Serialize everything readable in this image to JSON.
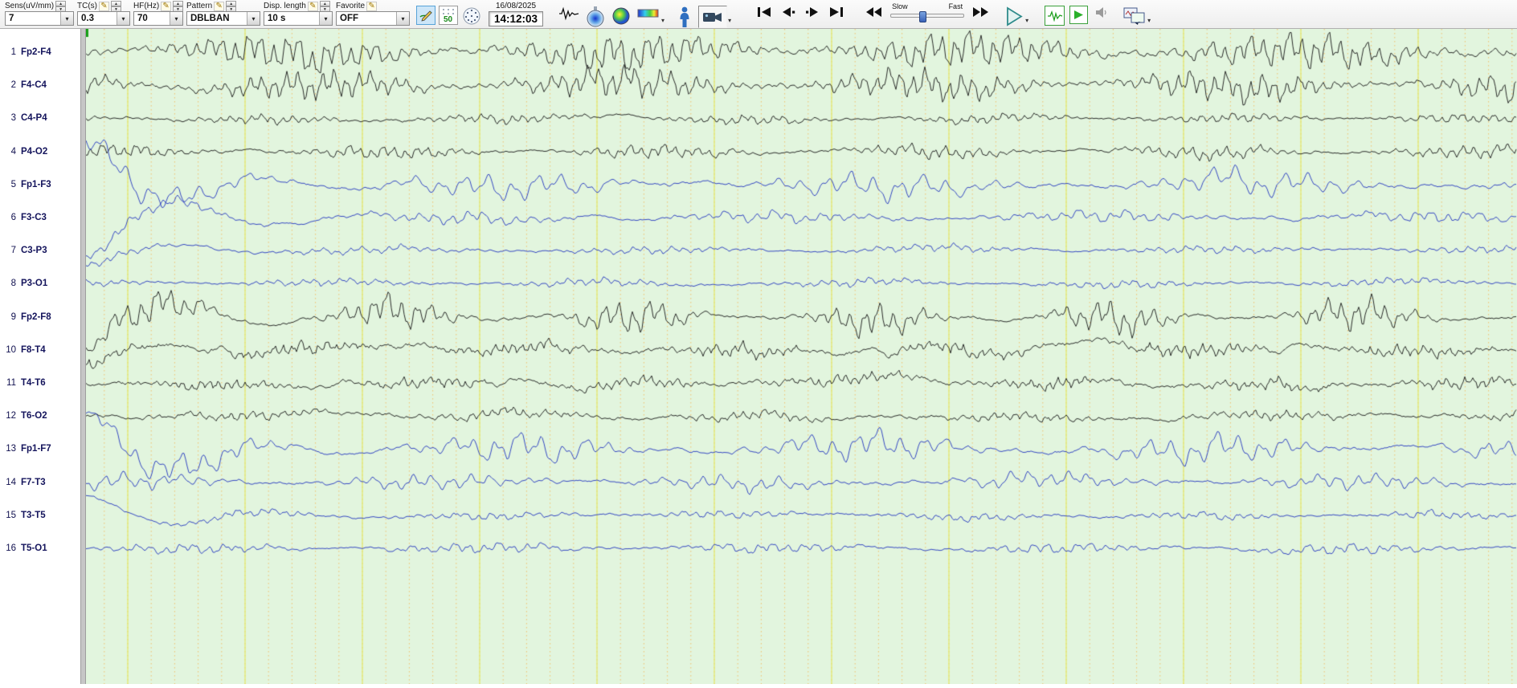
{
  "glyphs": {
    "pencil": "✎",
    "spin_up": "▲",
    "spin_down": "▼",
    "combo_arrow": "▾",
    "menu_arrow": "▾"
  },
  "toolbar": {
    "groups": [
      {
        "label": "Sens(uV/mm)",
        "value": "7"
      },
      {
        "label": "TC(s)",
        "value": "0.3"
      },
      {
        "label": "HF(Hz)",
        "value": "70"
      },
      {
        "label": "Pattern",
        "value": "DBLBAN"
      },
      {
        "label": "Disp. length",
        "value": "10 s"
      },
      {
        "label": "Favorite",
        "value": "OFF"
      }
    ],
    "notch": {
      "label": "50"
    },
    "datetime": {
      "date": "16/08/2025",
      "time": "14:12:03"
    },
    "transport": {
      "slow_label": "Slow",
      "fast_label": "Fast"
    }
  },
  "channels": [
    {
      "num": "1",
      "label": "Fp2-F4",
      "color": "black",
      "amp": 24,
      "T": 16,
      "burstT": 420,
      "burstK": 0.9,
      "noise": 1.5,
      "trans": 0,
      "seed": 101
    },
    {
      "num": "2",
      "label": "F4-C4",
      "color": "black",
      "amp": 20,
      "T": 15,
      "burstT": 380,
      "burstK": 0.9,
      "noise": 1.3,
      "trans": 0,
      "seed": 202
    },
    {
      "num": "3",
      "label": "C4-P4",
      "color": "black",
      "amp": 6,
      "T": 13,
      "burstT": 300,
      "burstK": 1.0,
      "noise": 1.0,
      "trans": 0,
      "seed": 303
    },
    {
      "num": "4",
      "label": "P4-O2",
      "color": "black",
      "amp": 9,
      "T": 14,
      "burstT": 340,
      "burstK": 1.2,
      "noise": 1.0,
      "trans": 0,
      "seed": 404
    },
    {
      "num": "5",
      "label": "Fp1-F3",
      "color": "blue",
      "amp": 18,
      "T": 30,
      "burstT": 460,
      "burstK": 1.2,
      "noise": 1.4,
      "trans": 55,
      "seed": 505
    },
    {
      "num": "6",
      "label": "F3-C3",
      "color": "blue",
      "amp": 8,
      "T": 20,
      "burstT": 400,
      "burstK": 1.1,
      "noise": 1.2,
      "trans": -50,
      "seed": 606
    },
    {
      "num": "7",
      "label": "C3-P3",
      "color": "blue",
      "amp": 5,
      "T": 16,
      "burstT": 350,
      "burstK": 1.0,
      "noise": 0.9,
      "trans": -18,
      "seed": 707
    },
    {
      "num": "8",
      "label": "P3-O1",
      "color": "blue",
      "amp": 5,
      "T": 15,
      "burstT": 330,
      "burstK": 1.0,
      "noise": 0.8,
      "trans": 0,
      "seed": 808
    },
    {
      "num": "9",
      "label": "Fp2-F8",
      "color": "black",
      "amp": 23,
      "T": 18,
      "burstT": 300,
      "burstK": 2.0,
      "noise": 1.5,
      "trans": -40,
      "seed": 909
    },
    {
      "num": "10",
      "label": "F8-T4",
      "color": "black",
      "amp": 8,
      "T": 11,
      "burstT": 280,
      "burstK": 1.0,
      "noise": 2.6,
      "trans": -20,
      "seed": 1010
    },
    {
      "num": "11",
      "label": "T4-T6",
      "color": "black",
      "amp": 7,
      "T": 11,
      "burstT": 260,
      "burstK": 1.0,
      "noise": 2.2,
      "trans": 0,
      "seed": 1111
    },
    {
      "num": "12",
      "label": "T6-O2",
      "color": "black",
      "amp": 6,
      "T": 13,
      "burstT": 320,
      "burstK": 1.0,
      "noise": 1.6,
      "trans": 0,
      "seed": 1212
    },
    {
      "num": "13",
      "label": "Fp1-F7",
      "color": "blue",
      "amp": 20,
      "T": 28,
      "burstT": 430,
      "burstK": 1.4,
      "noise": 1.4,
      "trans": 45,
      "seed": 1313
    },
    {
      "num": "14",
      "label": "F7-T3",
      "color": "blue",
      "amp": 11,
      "T": 24,
      "burstT": 380,
      "burstK": 1.2,
      "noise": 1.3,
      "trans": 0,
      "seed": 1414
    },
    {
      "num": "15",
      "label": "T3-T5",
      "color": "blue",
      "amp": 5,
      "T": 15,
      "burstT": 300,
      "burstK": 1.0,
      "noise": 1.0,
      "trans": 25,
      "seed": 1515
    },
    {
      "num": "16",
      "label": "T5-O1",
      "color": "blue",
      "amp": 7,
      "T": 18,
      "burstT": 360,
      "burstK": 1.1,
      "noise": 1.0,
      "trans": 0,
      "seed": 1616
    }
  ],
  "grid": {
    "background": "#e2f5de",
    "major_color": "#e4ea72",
    "minor_color": "#f2c06c",
    "major_spacing": 146,
    "minor_spacing": 29.2,
    "offset": 52,
    "row_start": 29,
    "row_spacing": 41.2
  },
  "colors": {
    "black_trace": "#161616",
    "blue_trace": "#2336c0",
    "label": "#14145c",
    "cursor_mark": "#18a018"
  }
}
